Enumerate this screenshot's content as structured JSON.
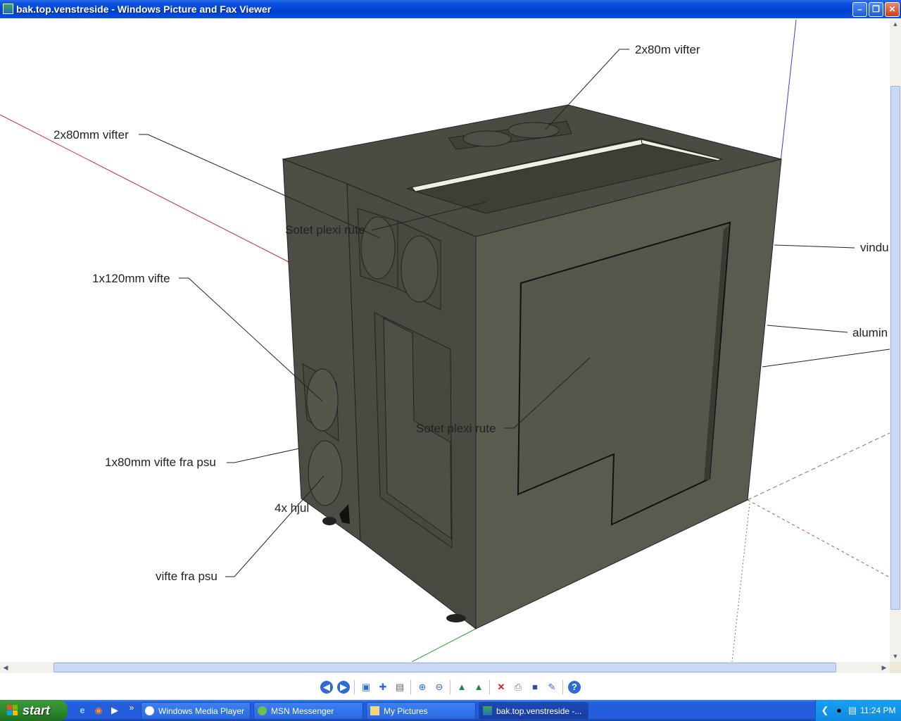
{
  "window": {
    "title": "bak.top.venstreside - Windows Picture and Fax Viewer",
    "minimize_glyph": "–",
    "maximize_glyph": "❐",
    "close_glyph": "✕"
  },
  "image": {
    "callouts": {
      "top_right": "2x80m vifter",
      "top_left": "2x80mm vifter",
      "plexi_top": "Sotet plexi rute",
      "fan_120": "1x120mm vifte",
      "fan_psu_80": "1x80mm vifte fra psu",
      "wheels": "4x hjul",
      "fan_psu": "vifte fra psu",
      "plexi_side": "Sotet plexi rute",
      "window_cut": "vindu",
      "aluminium_cut": "alumin"
    }
  },
  "toolbar": {
    "icons": [
      "previous-image-icon",
      "next-image-icon",
      "best-fit-icon",
      "actual-size-icon",
      "slideshow-icon",
      "zoom-in-icon",
      "zoom-out-icon",
      "rotate-clockwise-icon",
      "rotate-counterclockwise-icon",
      "delete-icon",
      "print-icon",
      "save-icon",
      "edit-icon",
      "help-icon"
    ]
  },
  "taskbar": {
    "start_label": "start",
    "quick_launch": [
      "internet-explorer-icon",
      "firefox-icon",
      "media-player-icon"
    ],
    "more_glyph": "»",
    "tasks": [
      {
        "label": "Windows Media Player",
        "icon": "media-player-icon"
      },
      {
        "label": "MSN Messenger",
        "icon": "msn-icon"
      },
      {
        "label": "My Pictures",
        "icon": "folder-icon"
      },
      {
        "label": "bak.top.venstreside -...",
        "icon": "picture-viewer-icon"
      }
    ],
    "clock": "11:24 PM"
  },
  "colors": {
    "titlebar": "#0A52E0",
    "taskbar": "#245EDC",
    "start": "#2F8A2F",
    "box_top": "#4B4B43",
    "box_front": "#5A5A4F",
    "box_side": "#4E4E45"
  }
}
